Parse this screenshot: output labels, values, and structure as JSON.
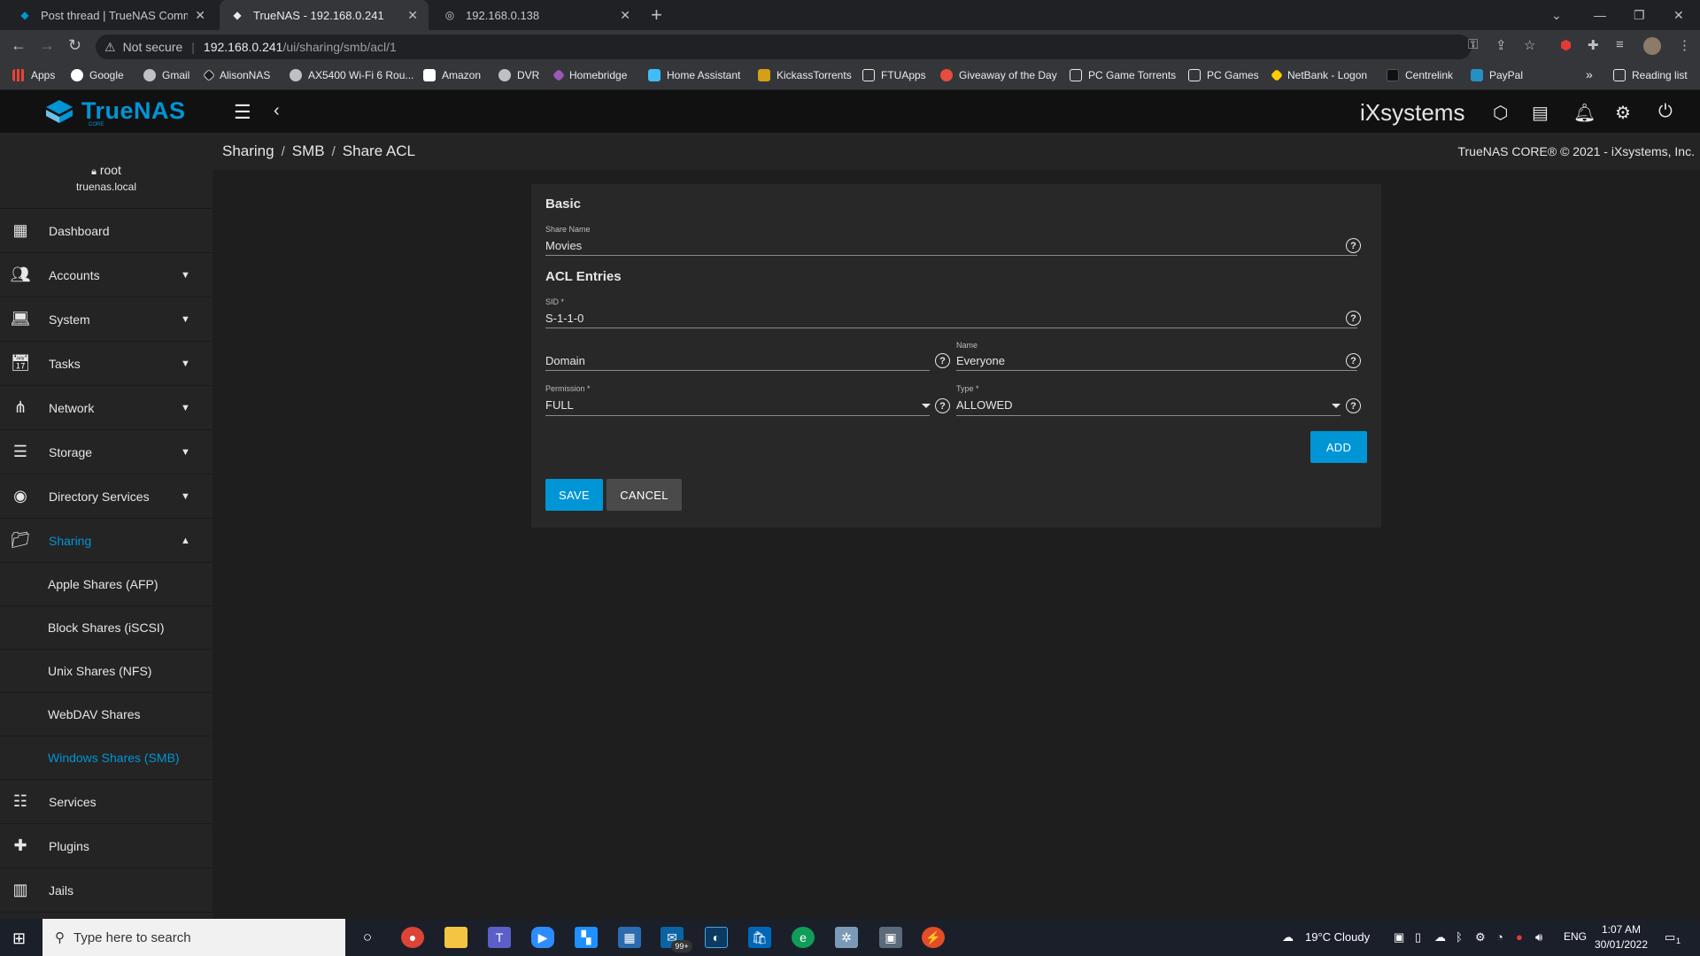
{
  "browser": {
    "tabs": [
      {
        "title": "Post thread | TrueNAS Communit",
        "active": false
      },
      {
        "title": "TrueNAS - 192.168.0.241",
        "active": true
      },
      {
        "title": "192.168.0.138",
        "active": false
      }
    ],
    "address": {
      "security": "Not secure",
      "host": "192.168.0.241",
      "path": "/ui/sharing/smb/acl/1"
    },
    "bookmarks": [
      {
        "label": "Apps",
        "color": "#e8eaed"
      },
      {
        "label": "Google",
        "color": "#ffffff"
      },
      {
        "label": "Gmail",
        "color": "#ffffff"
      },
      {
        "label": "AlisonNAS",
        "color": "#ffffff"
      },
      {
        "label": "AX5400 Wi-Fi 6 Rou...",
        "color": "#ffffff"
      },
      {
        "label": "Amazon",
        "color": "#ffffff"
      },
      {
        "label": "DVR",
        "color": "#ffffff"
      },
      {
        "label": "Homebridge",
        "color": "#9b59b6"
      },
      {
        "label": "Home Assistant",
        "color": "#41bdf5"
      },
      {
        "label": "KickassTorrents",
        "color": "#d4a017"
      },
      {
        "label": "FTUApps",
        "color": "#e8eaed"
      },
      {
        "label": "Giveaway of the Day",
        "color": "#e74c3c"
      },
      {
        "label": "PC Game Torrents",
        "color": "#e8eaed"
      },
      {
        "label": "PC Games",
        "color": "#e8eaed"
      },
      {
        "label": "NetBank - Logon",
        "color": "#ffcc00"
      },
      {
        "label": "Centrelink",
        "color": "#111111"
      },
      {
        "label": "PayPal",
        "color": "#2790c3"
      }
    ],
    "overflow": "»",
    "reading_list": "Reading list"
  },
  "app": {
    "brand": "TrueNAS",
    "brand_sub": "CORE",
    "vendor": "iXsystems",
    "accent": "#0095d5"
  },
  "breadcrumb": {
    "items": [
      "Sharing",
      "SMB",
      "Share ACL"
    ],
    "copyright": "TrueNAS CORE® © 2021 - iXsystems, Inc."
  },
  "user": {
    "name": "root",
    "host": "truenas.local"
  },
  "sidebar": {
    "items": [
      {
        "label": "Dashboard",
        "icon": "dashboard-icon",
        "arrow": ""
      },
      {
        "label": "Accounts",
        "icon": "people-icon",
        "arrow": "▼"
      },
      {
        "label": "System",
        "icon": "laptop-icon",
        "arrow": "▼"
      },
      {
        "label": "Tasks",
        "icon": "calendar-icon",
        "arrow": "▼"
      },
      {
        "label": "Network",
        "icon": "network-icon",
        "arrow": "▼"
      },
      {
        "label": "Storage",
        "icon": "storage-icon",
        "arrow": "▼"
      },
      {
        "label": "Directory Services",
        "icon": "directory-icon",
        "arrow": "▼"
      },
      {
        "label": "Sharing",
        "icon": "folder-shared-icon",
        "arrow": "▲"
      }
    ],
    "sharing_sub": [
      {
        "label": "Apple Shares (AFP)"
      },
      {
        "label": "Block Shares (iSCSI)"
      },
      {
        "label": "Unix Shares (NFS)"
      },
      {
        "label": "WebDAV Shares"
      },
      {
        "label": "Windows Shares (SMB)"
      }
    ],
    "bottom": [
      {
        "label": "Services",
        "icon": "tune-icon"
      },
      {
        "label": "Plugins",
        "icon": "puzzle-icon"
      },
      {
        "label": "Jails",
        "icon": "jail-icon"
      }
    ]
  },
  "form": {
    "basic_title": "Basic",
    "share_name_label": "Share Name",
    "share_name_value": "Movies",
    "acl_title": "ACL Entries",
    "sid_label": "SID *",
    "sid_value": "S-1-1-0",
    "domain_placeholder": "Domain",
    "name_label": "Name",
    "name_value": "Everyone",
    "permission_label": "Permission *",
    "permission_value": "FULL",
    "type_label": "Type *",
    "type_value": "ALLOWED",
    "add_label": "ADD",
    "save_label": "SAVE",
    "cancel_label": "CANCEL"
  },
  "taskbar": {
    "search_placeholder": "Type here to search",
    "mail_badge": "99+",
    "weather": "19°C  Cloudy",
    "language": "ENG",
    "time": "1:07 AM",
    "date": "30/01/2022",
    "notification_count": "1"
  }
}
